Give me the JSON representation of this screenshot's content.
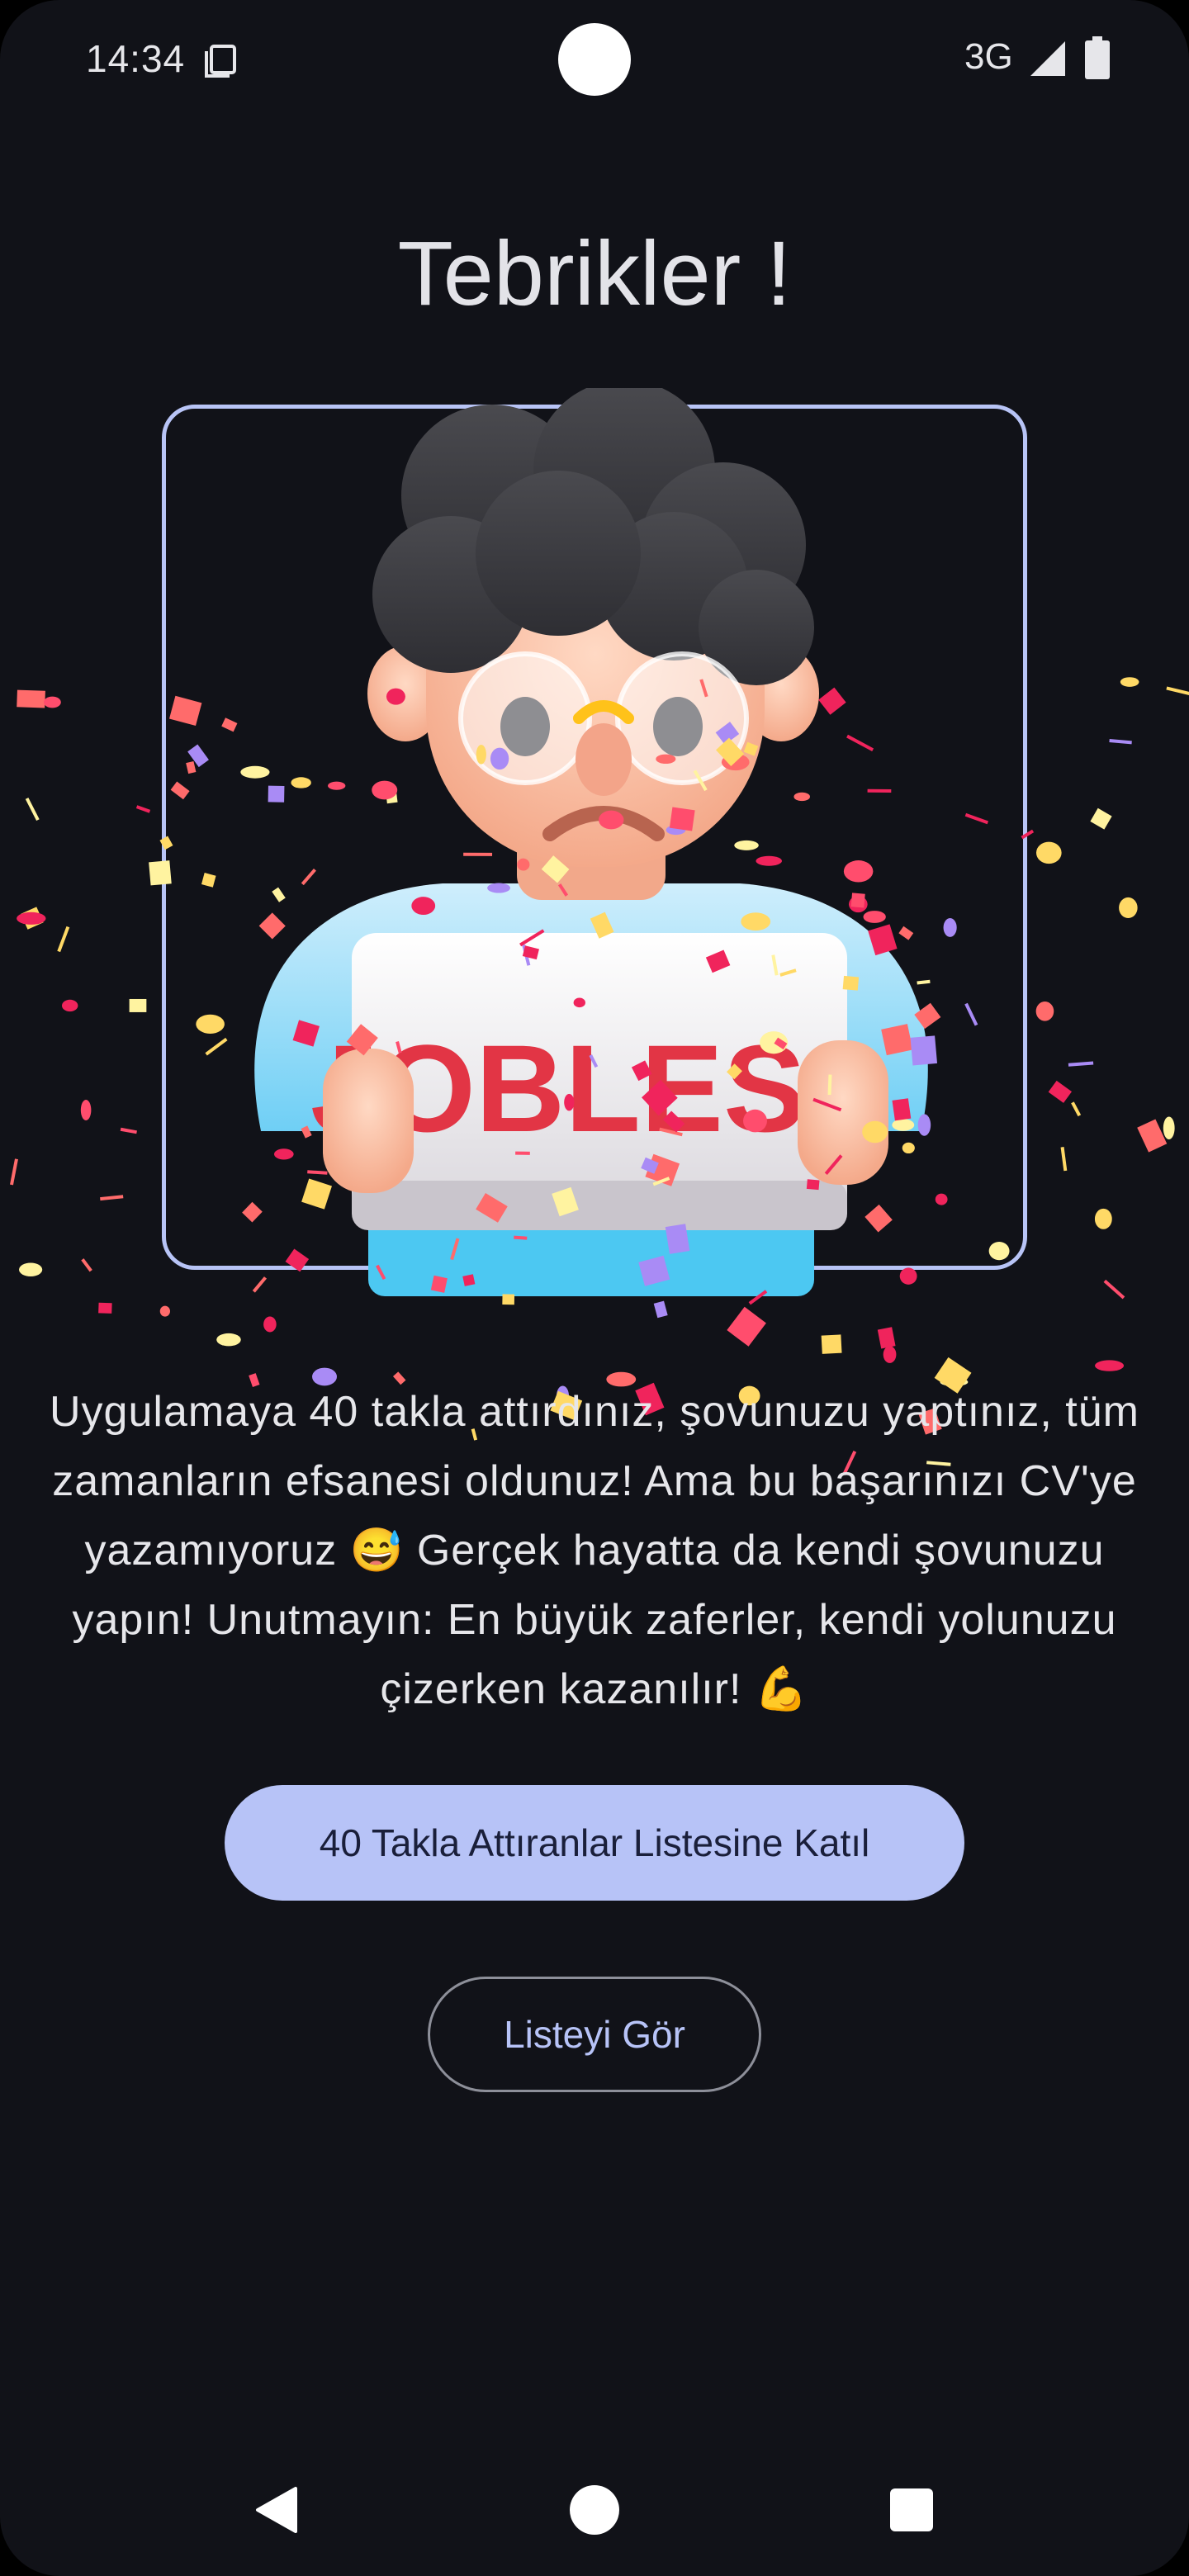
{
  "status_bar": {
    "time": "14:34",
    "network": "3G",
    "icons": [
      "sim-card-icon",
      "signal-icon",
      "battery-icon"
    ]
  },
  "title": "Tebrikler !",
  "illustration": {
    "sign_text": "JOBLESS",
    "icon": "jobless-character-illustration"
  },
  "message": "Uygulamaya 40 takla attırdınız, şovunuzu yaptınız, tüm zamanların efsanesi oldunuz! Ama bu başarınızı CV'ye yazamıyoruz 😅 Gerçek hayatta da kendi şovunuzu yapın! Unutmayın: En büyük zaferler, kendi yolunuzu çizerken kazanılır! 💪",
  "buttons": {
    "join_label": "40 Takla Attıranlar Listesine Katıl",
    "view_list_label": "Listeyi Gör"
  },
  "nav_bar": {
    "icons": [
      "back-triangle-icon",
      "home-circle-icon",
      "recents-square-icon"
    ]
  },
  "colors": {
    "background": "#111218",
    "accent": "#b7c3f7",
    "frame_border": "#b8c4f6",
    "text": "#e6e6ea",
    "confetti": [
      "#f0245c",
      "#ff6b6b",
      "#ffd966",
      "#a98bf5",
      "#fff3a0",
      "#ff4d6d"
    ]
  }
}
